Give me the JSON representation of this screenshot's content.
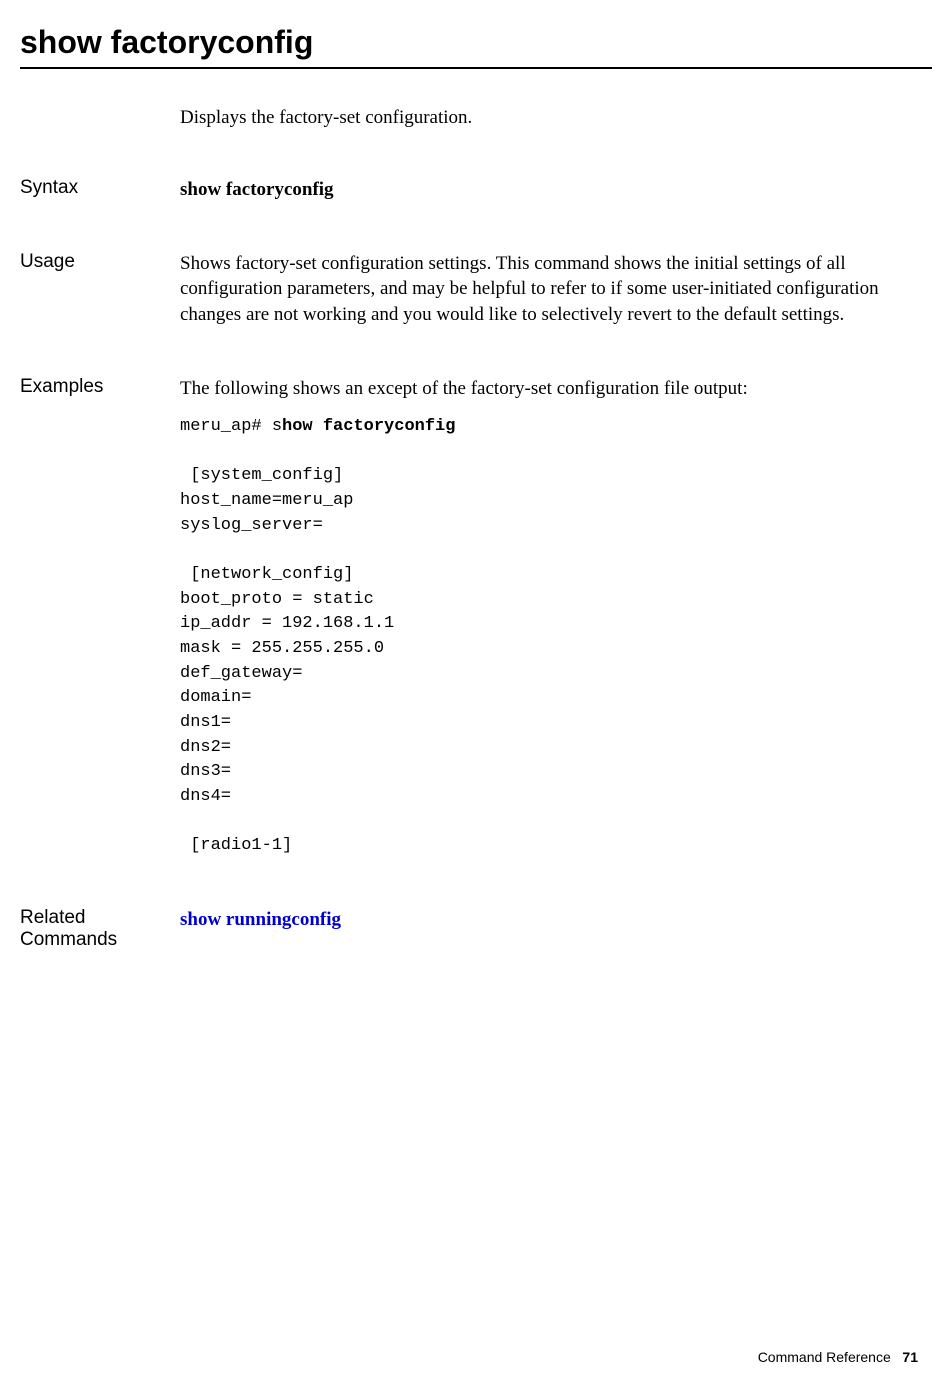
{
  "title": "show factoryconfig",
  "intro": "Displays the factory-set configuration.",
  "syntax": {
    "label": "Syntax",
    "value": "show factoryconfig"
  },
  "usage": {
    "label": "Usage",
    "text": "Shows factory-set configuration settings. This command shows the initial settings of all configuration parameters, and may be helpful to refer to if some user-initiated configuration changes are not working and you would like to selectively revert to the default settings."
  },
  "examples": {
    "label": "Examples",
    "intro": "The following shows an except of the factory-set configuration file output:",
    "prompt": "meru_ap# s",
    "command": "how factoryconfig",
    "output_lines": [
      "",
      " [system_config]",
      "host_name=meru_ap",
      "syslog_server=",
      "",
      " [network_config]",
      "boot_proto = static",
      "ip_addr = 192.168.1.1",
      "mask = 255.255.255.0",
      "def_gateway=",
      "domain=",
      "dns1=",
      "dns2=",
      "dns3=",
      "dns4=",
      "",
      " [radio1-1]"
    ]
  },
  "related": {
    "label": "Related Commands",
    "link_text": "show runningconfig"
  },
  "footer": {
    "section": "Command Reference",
    "page": "71"
  }
}
